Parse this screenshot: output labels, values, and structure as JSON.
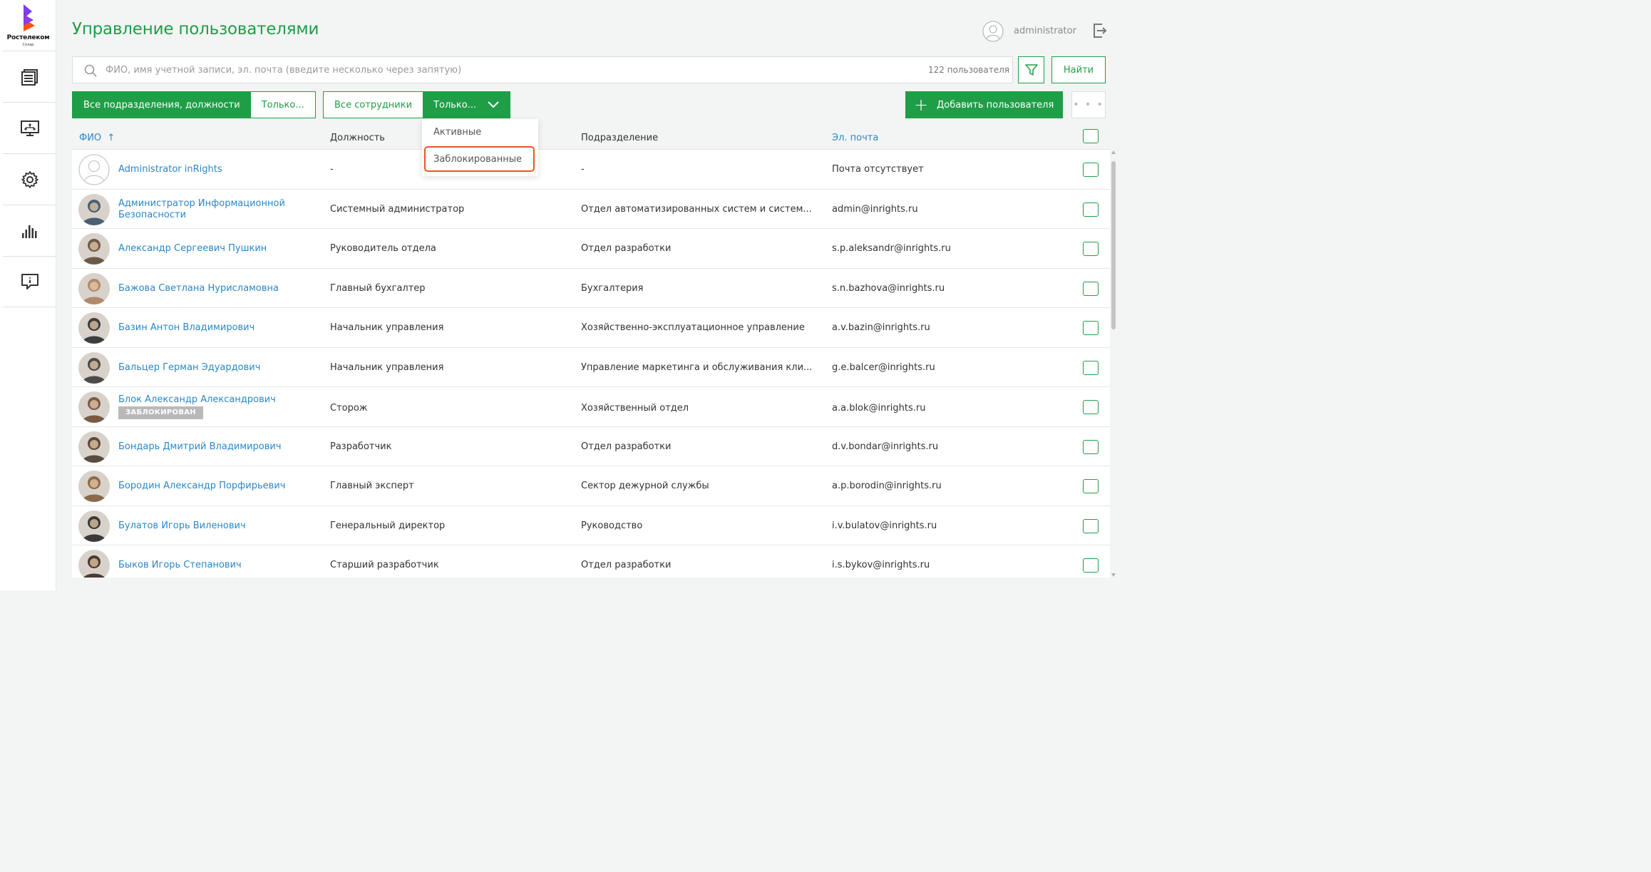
{
  "logo": {
    "brand": "Ростелеком",
    "sub": "Солар"
  },
  "sidebar": {
    "items": [
      {
        "icon": "documents-icon"
      },
      {
        "icon": "monitor-network-icon"
      },
      {
        "icon": "gear-icon"
      },
      {
        "icon": "bar-chart-icon"
      },
      {
        "icon": "feedback-icon"
      }
    ]
  },
  "header": {
    "title": "Управление пользователями",
    "username": "administrator"
  },
  "search": {
    "placeholder": "ФИО, имя учетной записи, эл. почта (введите несколько через запятую)",
    "value": "",
    "count": "122 пользователя",
    "find_label": "Найти"
  },
  "filters": {
    "dept_all": "Все подразделения, должности",
    "dept_only": "Только...",
    "emp_all": "Все сотрудники",
    "emp_only": "Только...",
    "add_user": "Добавить пользователя",
    "more": "• • •"
  },
  "dropdown": {
    "items": [
      "Активные",
      "Заблокированные"
    ],
    "highlighted": 1
  },
  "table": {
    "columns": {
      "name": "ФИО",
      "position": "Должность",
      "department": "Подразделение",
      "email": "Эл. почта"
    },
    "sort_indicator": "↑",
    "rows": [
      {
        "name": "Administrator inRights",
        "position": "-",
        "department": "-",
        "email": "Почта отсутствует",
        "avatar": "placeholder",
        "blocked": ""
      },
      {
        "name": "Администратор Информационной Безопасности",
        "position": "Системный администратор",
        "department": "Отдел автоматизированных систем и систем...",
        "email": "admin@inrights.ru",
        "avatar": "#4a5f73",
        "blocked": ""
      },
      {
        "name": "Александр Сергеевич Пушкин",
        "position": "Руководитель отдела",
        "department": "Отдел разработки",
        "email": "s.p.aleksandr@inrights.ru",
        "avatar": "#6b5a48",
        "blocked": ""
      },
      {
        "name": "Бажова Светлана Нурисламовна",
        "position": "Главный бухгалтер",
        "department": "Бухгалтерия",
        "email": "s.n.bazhova@inrights.ru",
        "avatar": "#b08a6a",
        "blocked": ""
      },
      {
        "name": "Базин Антон Владимирович",
        "position": "Начальник управления",
        "department": "Хозяйственно-эксплуатационное управление",
        "email": "a.v.bazin@inrights.ru",
        "avatar": "#3d3d3d",
        "blocked": ""
      },
      {
        "name": "Бальцер Герман Эдуардович",
        "position": "Начальник управления",
        "department": "Управление маркетинга и обслуживания кли...",
        "email": "g.e.balcer@inrights.ru",
        "avatar": "#4b4b4b",
        "blocked": ""
      },
      {
        "name": "Блок Александр Александрович",
        "position": "Сторож",
        "department": "Хозяйственный отдел",
        "email": "a.a.blok@inrights.ru",
        "avatar": "#7a5a45",
        "blocked": "ЗАБЛОКИРОВАН"
      },
      {
        "name": "Бондарь Дмитрий Владимирович",
        "position": "Разработчик",
        "department": "Отдел разработки",
        "email": "d.v.bondar@inrights.ru",
        "avatar": "#5a4a3f",
        "blocked": ""
      },
      {
        "name": "Бородин Александр Порфирьевич",
        "position": "Главный эксперт",
        "department": "Сектор дежурной службы",
        "email": "a.p.borodin@inrights.ru",
        "avatar": "#8a6a4a",
        "blocked": ""
      },
      {
        "name": "Булатов Игорь Виленович",
        "position": "Генеральный директор",
        "department": "Руководство",
        "email": "i.v.bulatov@inrights.ru",
        "avatar": "#3a3a3a",
        "blocked": ""
      },
      {
        "name": "Быков Игорь Степанович",
        "position": "Старший разработчик",
        "department": "Отдел разработки",
        "email": "i.s.bykov@inrights.ru",
        "avatar": "#4a3a30",
        "blocked": ""
      }
    ]
  },
  "colors": {
    "primary": "#1f9e47",
    "link": "#2a87c8",
    "highlight": "#e8552a",
    "badge": "#b9b9b9"
  }
}
